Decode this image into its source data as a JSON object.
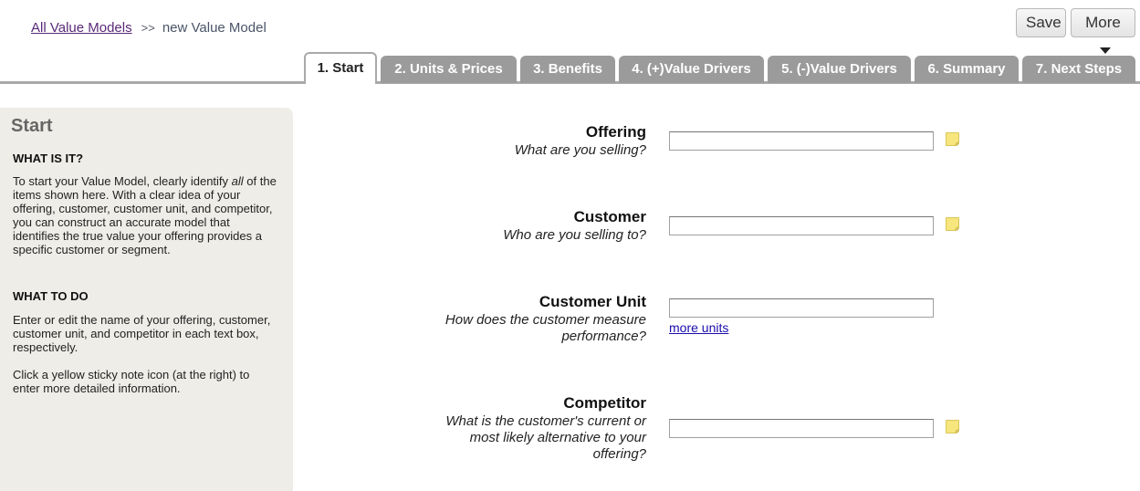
{
  "breadcrumb": {
    "link": "All Value Models",
    "separator": ">>",
    "current": "new Value Model"
  },
  "toolbar": {
    "save_label": "Save",
    "more_label": "More"
  },
  "tabs": [
    {
      "label": "1. Start",
      "active": true
    },
    {
      "label": "2. Units & Prices"
    },
    {
      "label": "3. Benefits"
    },
    {
      "label": "4. (+)Value Drivers"
    },
    {
      "label": "5. (-)Value Drivers"
    },
    {
      "label": "6. Summary"
    },
    {
      "label": "7. Next Steps"
    }
  ],
  "sidebar": {
    "title": "Start",
    "what_heading": "WHAT IS IT?",
    "what_text_1": "To start your Value Model, clearly identify ",
    "what_text_em": "all",
    "what_text_2": " of the items shown here. With a clear idea of your offering, customer, customer unit, and competitor, you can construct an accurate model that identifies the true value your offering provides a specific customer or segment.",
    "todo_heading": "WHAT TO DO",
    "todo_text_1": "Enter or edit the name of your offering, customer, customer unit, and competitor in each text box, respectively.",
    "todo_text_2": "Click a yellow sticky note icon (at the right) to enter more detailed information."
  },
  "form": {
    "offering": {
      "label": "Offering",
      "hint": "What are you selling?",
      "value": ""
    },
    "customer": {
      "label": "Customer",
      "hint": "Who are you selling to?",
      "value": ""
    },
    "customer_unit": {
      "label": "Customer Unit",
      "hint_1": "How does the customer measure",
      "hint_2": "performance?",
      "value": "",
      "more_link": "more units"
    },
    "competitor": {
      "label": "Competitor",
      "hint_1": "What is the customer's current or",
      "hint_2": "most likely alternative to your",
      "hint_3": "offering?",
      "value": ""
    }
  },
  "colors": {
    "tab_inactive": "#9b9b9b",
    "panel_bg": "#efede7",
    "sticky_note": "#f6e67d",
    "link": "#1a0dab"
  }
}
